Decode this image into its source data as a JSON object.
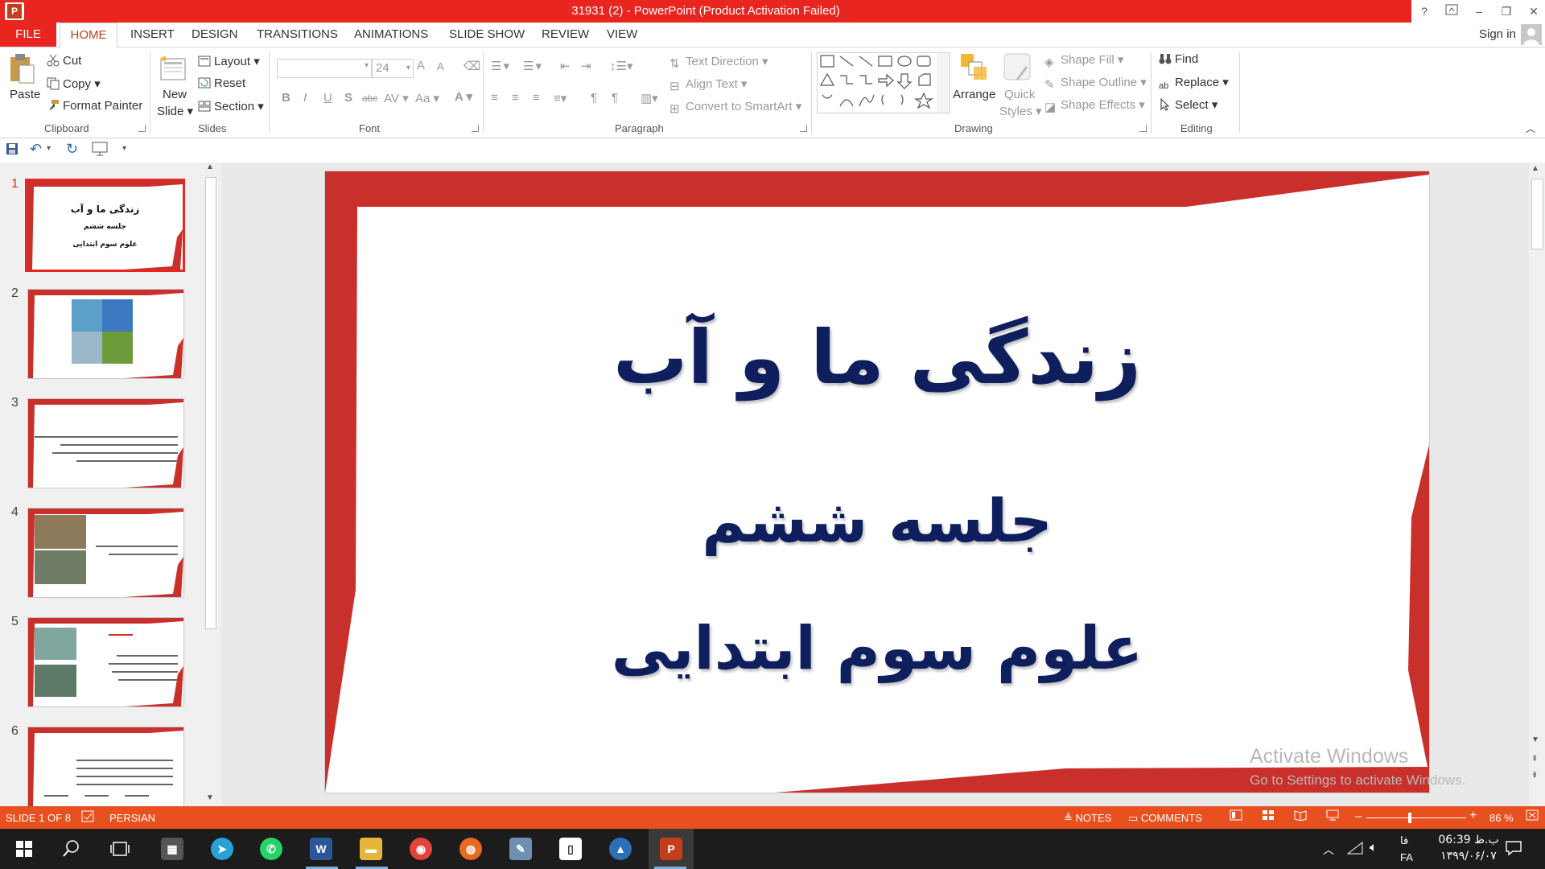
{
  "window": {
    "title": "31931 (2) -  PowerPoint (Product Activation Failed)",
    "app_icon_letter": "P",
    "help": "?",
    "restore_ribbon": "↗",
    "minimize": "–",
    "maximize": "❐",
    "close": "✕"
  },
  "tabs": [
    "FILE",
    "HOME",
    "INSERT",
    "DESIGN",
    "TRANSITIONS",
    "ANIMATIONS",
    "SLIDE SHOW",
    "REVIEW",
    "VIEW"
  ],
  "signin": "Sign in",
  "ribbon": {
    "clipboard": {
      "label": "Clipboard",
      "paste": "Paste",
      "cut": "Cut",
      "copy": "Copy",
      "format_painter": "Format Painter"
    },
    "slides": {
      "label": "Slides",
      "new_slide_1": "New",
      "new_slide_2": "Slide",
      "layout": "Layout",
      "reset": "Reset",
      "section": "Section"
    },
    "font": {
      "label": "Font",
      "font_name": "",
      "font_size": "24",
      "bold": "B",
      "italic": "I",
      "underline": "U",
      "shadow": "S",
      "strike": "abc",
      "spacing": "AV",
      "case": "Aa",
      "color": "A",
      "grow": "A",
      "shrink": "A"
    },
    "paragraph": {
      "label": "Paragraph",
      "text_direction": "Text Direction",
      "align_text": "Align Text",
      "convert_smartart": "Convert to SmartArt"
    },
    "drawing": {
      "label": "Drawing",
      "arrange": "Arrange",
      "quick_styles_1": "Quick",
      "quick_styles_2": "Styles",
      "shape_fill": "Shape Fill",
      "shape_outline": "Shape Outline",
      "shape_effects": "Shape Effects"
    },
    "editing": {
      "label": "Editing",
      "find": "Find",
      "replace": "Replace",
      "select": "Select"
    }
  },
  "thumbnails": {
    "numbers": [
      "1",
      "2",
      "3",
      "4",
      "5",
      "6"
    ],
    "slide1_lines": [
      "زندگی ما و آب",
      "جلسه ششم",
      "علوم سوم ابتدایی"
    ]
  },
  "slide": {
    "title": "زندگی ما و آب",
    "subtitle": "جلسه  ششم",
    "line3": "علوم سوم ابتدایی"
  },
  "watermark": {
    "line1": "Activate Windows",
    "line2": "Go to Settings to activate Windows."
  },
  "status": {
    "slide_of": "SLIDE 1 OF 8",
    "language": "PERSIAN",
    "notes": "NOTES",
    "comments": "COMMENTS",
    "zoom": "86 %"
  },
  "taskbar": {
    "time": "06:39 ب.ظ",
    "date": "۱۳۹۹/۰۶/۰۷",
    "lang1": "فا",
    "lang2": "FA"
  },
  "colors": {
    "accent": "#e8251f",
    "status": "#e8511f",
    "slide_red": "#c9302b",
    "title_text": "#0f1f5e"
  }
}
